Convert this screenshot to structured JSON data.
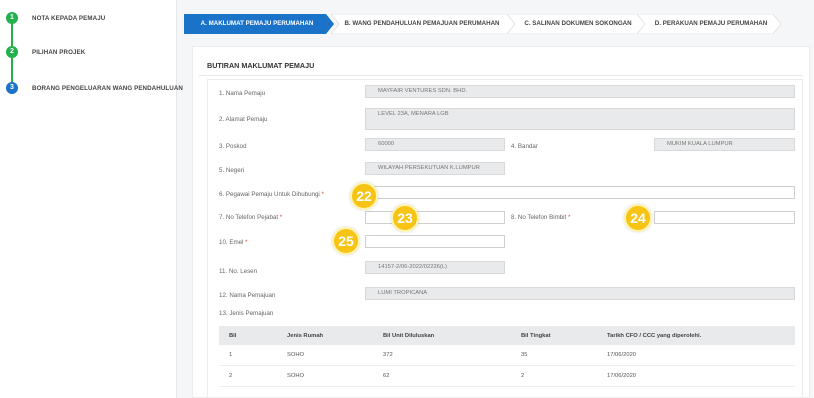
{
  "sidebar": {
    "steps": [
      {
        "number": "1",
        "label": "NOTA KEPADA PEMAJU",
        "color": "#22b14c"
      },
      {
        "number": "2",
        "label": "PILIHAN PROJEK",
        "color": "#22b14c"
      },
      {
        "number": "3",
        "label": "BORANG PENGELUARAN WANG PENDAHULUAN",
        "color": "#1a73c8"
      }
    ]
  },
  "tabs": [
    {
      "label": "A. MAKLUMAT PEMAJU PERUMAHAN",
      "active": true
    },
    {
      "label": "B. WANG PENDAHULUAN PEMAJUAN PERUMAHAN",
      "active": false
    },
    {
      "label": "C. SALINAN DOKUMEN SOKONGAN",
      "active": false
    },
    {
      "label": "D. PERAKUAN PEMAJU PERUMAHAN",
      "active": false
    }
  ],
  "section_title": "BUTIRAN MAKLUMAT PEMAJU",
  "fields": {
    "nama_pemaju": {
      "label": "1. Nama Pemaju",
      "value": "MAYFAIR VENTURES SDN. BHD."
    },
    "alamat_pemaju": {
      "label": "2. Alamat Pemaju",
      "value": "LEVEL 23A, MENARA LGB"
    },
    "poskod": {
      "label": "3. Poskod",
      "value": "60000"
    },
    "bandar": {
      "label": "4. Bandar",
      "value": "MUKIM KUALA LUMPUR"
    },
    "negeri": {
      "label": "5. Negeri",
      "value": "WILAYAH PERSEKUTUAN K.LUMPUR"
    },
    "pegawai": {
      "label": "6. Pegawai Pemaju Untuk Dihubungi",
      "required": "*",
      "value": ""
    },
    "telefon_pejabat": {
      "label": "7. No Telefon Pejabat",
      "required": "*",
      "value": ""
    },
    "telefon_bimbit": {
      "label": "8. No Telefon Bimbit",
      "required": "*",
      "value": ""
    },
    "emel": {
      "label": "10. Emel",
      "required": "*",
      "value": ""
    },
    "no_lesen": {
      "label": "11. No. Lesen",
      "value": "14157-2/06-2022/02226(L)"
    },
    "nama_pemajuan": {
      "label": "12. Nama Pemajuan",
      "value": "LUMI TROPICANA"
    },
    "jenis_pemajuan": {
      "label": "13. Jenis Pemajuan"
    }
  },
  "badges": [
    "22",
    "23",
    "24",
    "25"
  ],
  "table": {
    "headers": [
      "Bil",
      "Jenis Rumah",
      "Bil Unit Diluluskan",
      "Bil Tingkat",
      "Tarikh CFO / CCC yang diperolehi."
    ],
    "rows": [
      [
        "1",
        "SOHO",
        "372",
        "35",
        "17/06/2020"
      ],
      [
        "2",
        "SOHO",
        "62",
        "2",
        "17/06/2020"
      ]
    ]
  },
  "colors": {
    "accent": "#1a73c8",
    "done": "#22b14c",
    "badge": "#f7c415"
  }
}
